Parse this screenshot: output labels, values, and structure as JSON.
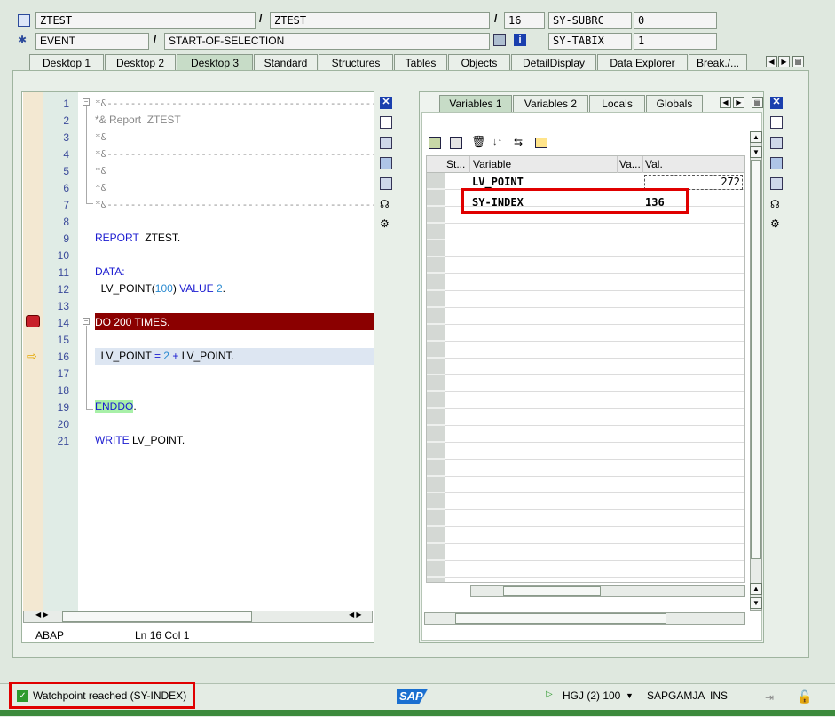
{
  "header": {
    "program": "ZTEST",
    "include": "ZTEST",
    "line": "16",
    "event_type": "EVENT",
    "event": "START-OF-SELECTION",
    "sysvar1_name": "SY-SUBRC",
    "sysvar1_value": "0",
    "sysvar2_name": "SY-TABIX",
    "sysvar2_value": "1",
    "slash": "/"
  },
  "tabs": [
    "Desktop 1",
    "Desktop 2",
    "Desktop 3",
    "Standard",
    "Structures",
    "Tables",
    "Objects",
    "DetailDisplay",
    "Data Explorer",
    "Break./..."
  ],
  "editor": {
    "lines": [
      "1",
      "2",
      "3",
      "4",
      "5",
      "6",
      "7",
      "8",
      "9",
      "10",
      "11",
      "12",
      "13",
      "14",
      "15",
      "16",
      "17",
      "18",
      "19",
      "20",
      "21"
    ],
    "c1": "*&---------------------------------------------------------------------*",
    "c2": "*& Report  ZTEST",
    "c3": "*&",
    "c4": "*&---------------------------------------------------------------------*",
    "c5": "*&",
    "c6": "*&",
    "c7": "*&---------------------------------------------------------------------*",
    "report_kw": "REPORT",
    "report_name": "ZTEST.",
    "data_kw": "DATA:",
    "lv_decl": "LV_POINT(",
    "lv_len": "100",
    "lv_close": ")",
    "value_kw": "VALUE",
    "value_num": "2",
    "value_dot": ".",
    "do_line": "DO 200 TIMES.",
    "assign_lhs": "LV_POINT",
    "assign_eq": "=",
    "assign_num": "2",
    "assign_plus": "+",
    "assign_rhs": "LV_POINT.",
    "enddo": "ENDDO",
    "enddo_dot": ".",
    "write_kw": "WRITE",
    "write_arg": "LV_POINT."
  },
  "editor_status": {
    "lang": "ABAP",
    "ln_label": "Ln",
    "ln": "16",
    "col_label": "Col",
    "col": "1"
  },
  "var_tabs": [
    "Variables 1",
    "Variables 2",
    "Locals",
    "Globals"
  ],
  "var_table": {
    "col_status": "St...",
    "col_variable": "Variable",
    "col_va": "Va...",
    "col_val": "Val.",
    "rows": [
      {
        "variable": "LV_POINT",
        "value": "272"
      },
      {
        "variable": "SY-INDEX",
        "value": "136"
      }
    ]
  },
  "statusbar": {
    "message": "Watchpoint reached (SY-INDEX)",
    "system": "HGJ (2) 100",
    "server": "SAPGAMJA",
    "mode": "INS",
    "logo": "SAP"
  },
  "colors": {
    "current_break_line": "#8b0000",
    "highlight_box": "#e00000",
    "exec_line": "#dde6f2"
  }
}
